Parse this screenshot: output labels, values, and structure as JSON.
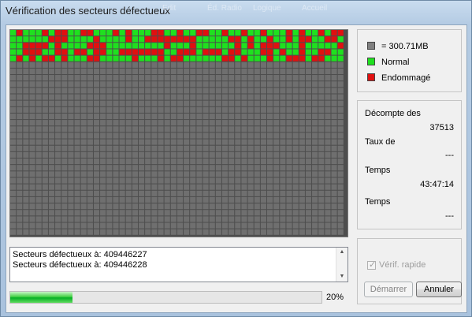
{
  "window": {
    "title": "Vérification des secteurs défectueux",
    "background_menu": [
      "Edit",
      "Éd. Radio",
      "Logique",
      "Accueil"
    ]
  },
  "map": {
    "colors": {
      "unscanned": "#6f6f6f",
      "normal": "#1fe01f",
      "damaged": "#e01010",
      "gridline": "#4d4d4d"
    },
    "scanned_rows": 5
  },
  "legend": {
    "block_size": "= 300.71MB",
    "normal": "Normal",
    "damaged": "Endommagé"
  },
  "stats": {
    "count_label": "Décompte des",
    "count_value": "37513",
    "rate_label": "Taux de",
    "rate_value": "---",
    "elapsed_label": "Temps",
    "elapsed_value": "43:47:14",
    "remaining_label": "Temps",
    "remaining_value": "---"
  },
  "log": {
    "lines": [
      "Secteurs défectueux à: 409446227",
      "Secteurs défectueux à: 409446228"
    ]
  },
  "progress": {
    "value": 0.2,
    "label": "20%"
  },
  "options": {
    "quick_verify_label": "Vérif. rapide",
    "quick_verify_checked": true
  },
  "buttons": {
    "start": "Démarrer",
    "cancel": "Annuler"
  }
}
